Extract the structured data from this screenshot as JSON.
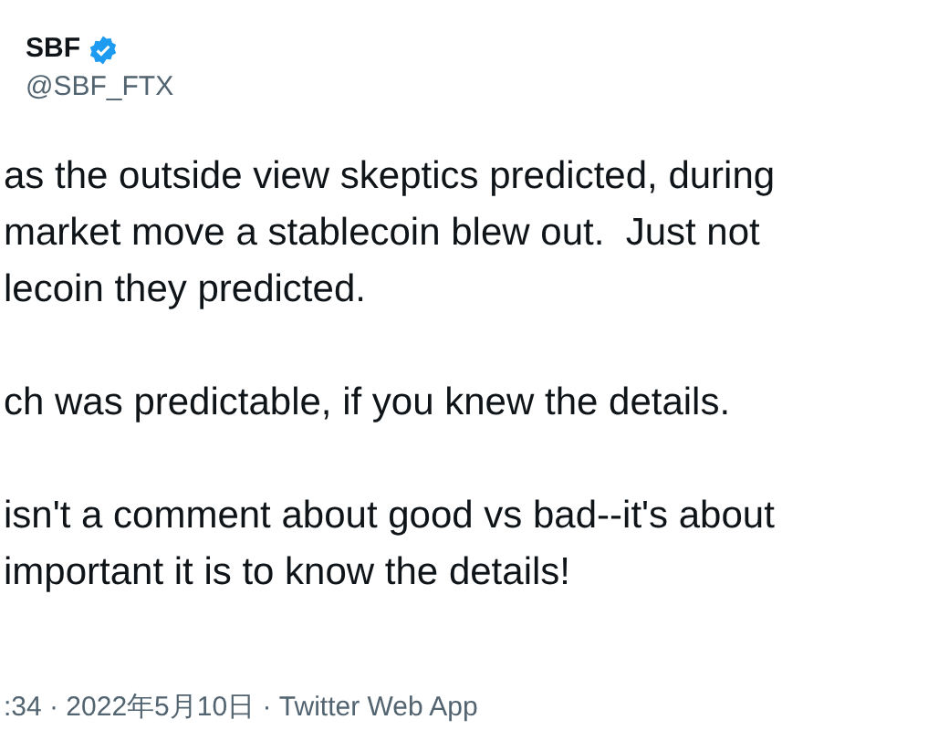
{
  "tweet": {
    "author": {
      "name": "SBF",
      "verified": true,
      "handle": "@SBF_FTX"
    },
    "paragraphs": [
      [
        "as the outside view skeptics predicted, during",
        "market move a stablecoin blew out.  Just not",
        "lecoin they predicted."
      ],
      [
        "ch was predictable, if you knew the details."
      ],
      [
        "isn't a comment about good vs bad--it's about",
        "important it is to know the details!"
      ]
    ],
    "meta": ":34 · 2022年5月10日 · Twitter Web App"
  }
}
